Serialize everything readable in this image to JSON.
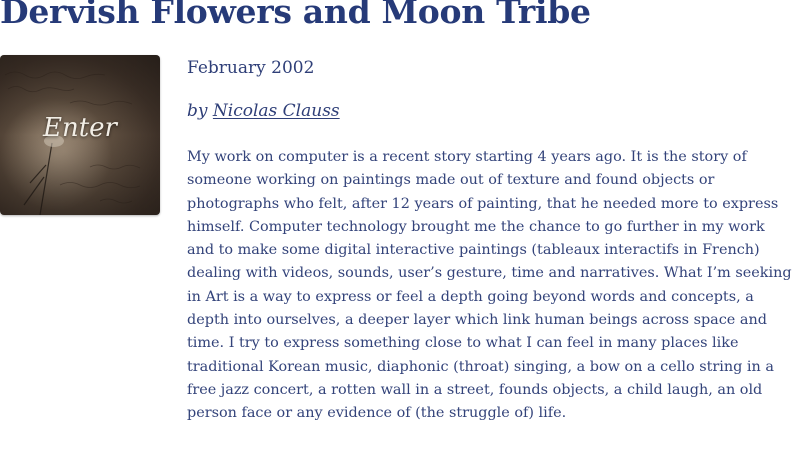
{
  "page": {
    "title": "Dervish Flowers and Moon Tribe"
  },
  "thumbnail": {
    "label": "Enter"
  },
  "meta": {
    "date": "February 2002",
    "by_prefix": "by",
    "author": "Nicolas Clauss"
  },
  "body": {
    "text": "My work on computer is a recent story starting 4 years ago. It is the story of someone working on paintings made out of texture and found objects or photographs who felt, after 12 years of painting, that he needed more to express himself. Computer technology brought me the chance to go further in my work and to make some digital interactive paintings (tableaux interactifs in French) dealing with videos, sounds, user’s gesture, time and narratives. What I’m seeking in Art is a way to express or feel a depth going beyond words and concepts, a depth into ourselves, a deeper layer which link human beings across space and time. I try to express something close to what I can feel in many places like traditional Korean music, diaphonic (throat) singing, a bow on a cello string in a free jazz concert, a rotten wall in a street, founds objects, a child laugh, an old person face or any evidence of (the struggle of) life."
  }
}
